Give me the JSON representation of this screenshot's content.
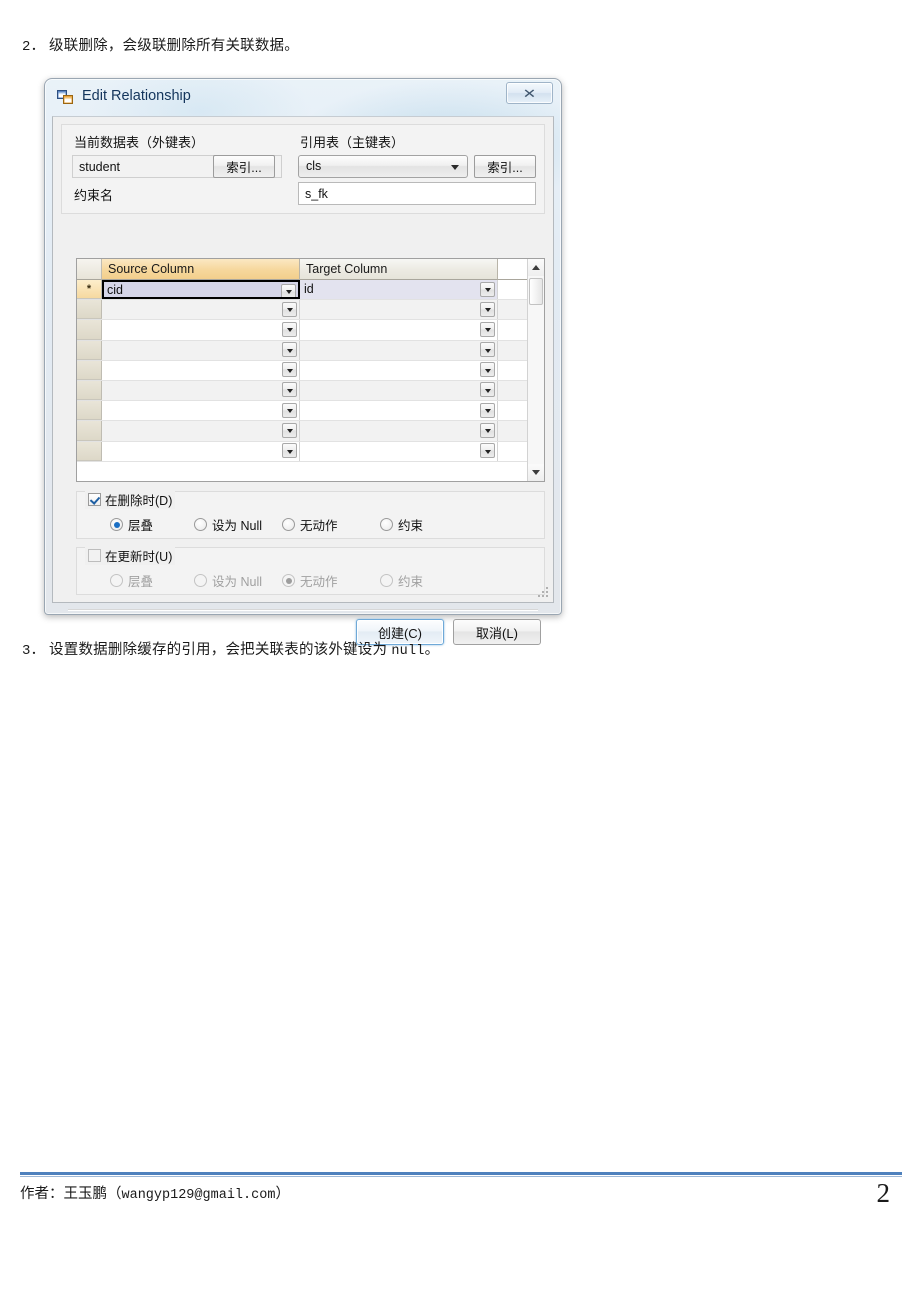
{
  "document": {
    "item2": {
      "number": "2．",
      "text": "级联删除，会级联删除所有关联数据。"
    },
    "item3": {
      "number": "3．",
      "text_before": "设置数据删除缓存的引用，会把关联表的该外键设为 ",
      "code": "null",
      "text_after": "。"
    }
  },
  "footer": {
    "author_prefix": "作者：王玉鹏（",
    "email": "wangyp129@gmail.com",
    "author_suffix": "）",
    "page_number": "2",
    "rule_color": "#4f81bd"
  },
  "dialog": {
    "title": "Edit Relationship",
    "icon": "relationship-tables-icon",
    "close_glyph": "✕",
    "fields": {
      "current_table_label": "当前数据表（外键表）",
      "referenced_table_label": "引用表（主键表）",
      "current_table_value": "student",
      "referenced_table_value": "cls",
      "index_button_1": "索引...",
      "index_button_2": "索引...",
      "constraint_name_label": "约束名",
      "constraint_name_value": "s_fk"
    },
    "grid": {
      "columns": [
        "Source Column",
        "Target Column"
      ],
      "selected_header": "Source Column",
      "rows": [
        {
          "marker": "*",
          "current": true,
          "source": "cid",
          "target": "id"
        },
        {
          "marker": "",
          "current": false,
          "source": "",
          "target": ""
        },
        {
          "marker": "",
          "current": false,
          "source": "",
          "target": ""
        },
        {
          "marker": "",
          "current": false,
          "source": "",
          "target": ""
        },
        {
          "marker": "",
          "current": false,
          "source": "",
          "target": ""
        },
        {
          "marker": "",
          "current": false,
          "source": "",
          "target": ""
        },
        {
          "marker": "",
          "current": false,
          "source": "",
          "target": ""
        },
        {
          "marker": "",
          "current": false,
          "source": "",
          "target": ""
        },
        {
          "marker": "",
          "current": false,
          "source": "",
          "target": ""
        }
      ],
      "header_accent": "#f3cf8c",
      "selected_cell_fill": "#d5d5e8"
    },
    "on_delete": {
      "label": "在删除时(D)",
      "checked": true,
      "enabled": true,
      "options": [
        "层叠",
        "设为 Null",
        "无动作",
        "约束"
      ],
      "selected": "层叠"
    },
    "on_update": {
      "label": "在更新时(U)",
      "checked": false,
      "enabled": false,
      "options": [
        "层叠",
        "设为 Null",
        "无动作",
        "约束"
      ],
      "selected": "无动作"
    },
    "buttons": {
      "create": "创建(C)",
      "cancel": "取消(L)",
      "default_button": "创建(C)"
    }
  }
}
